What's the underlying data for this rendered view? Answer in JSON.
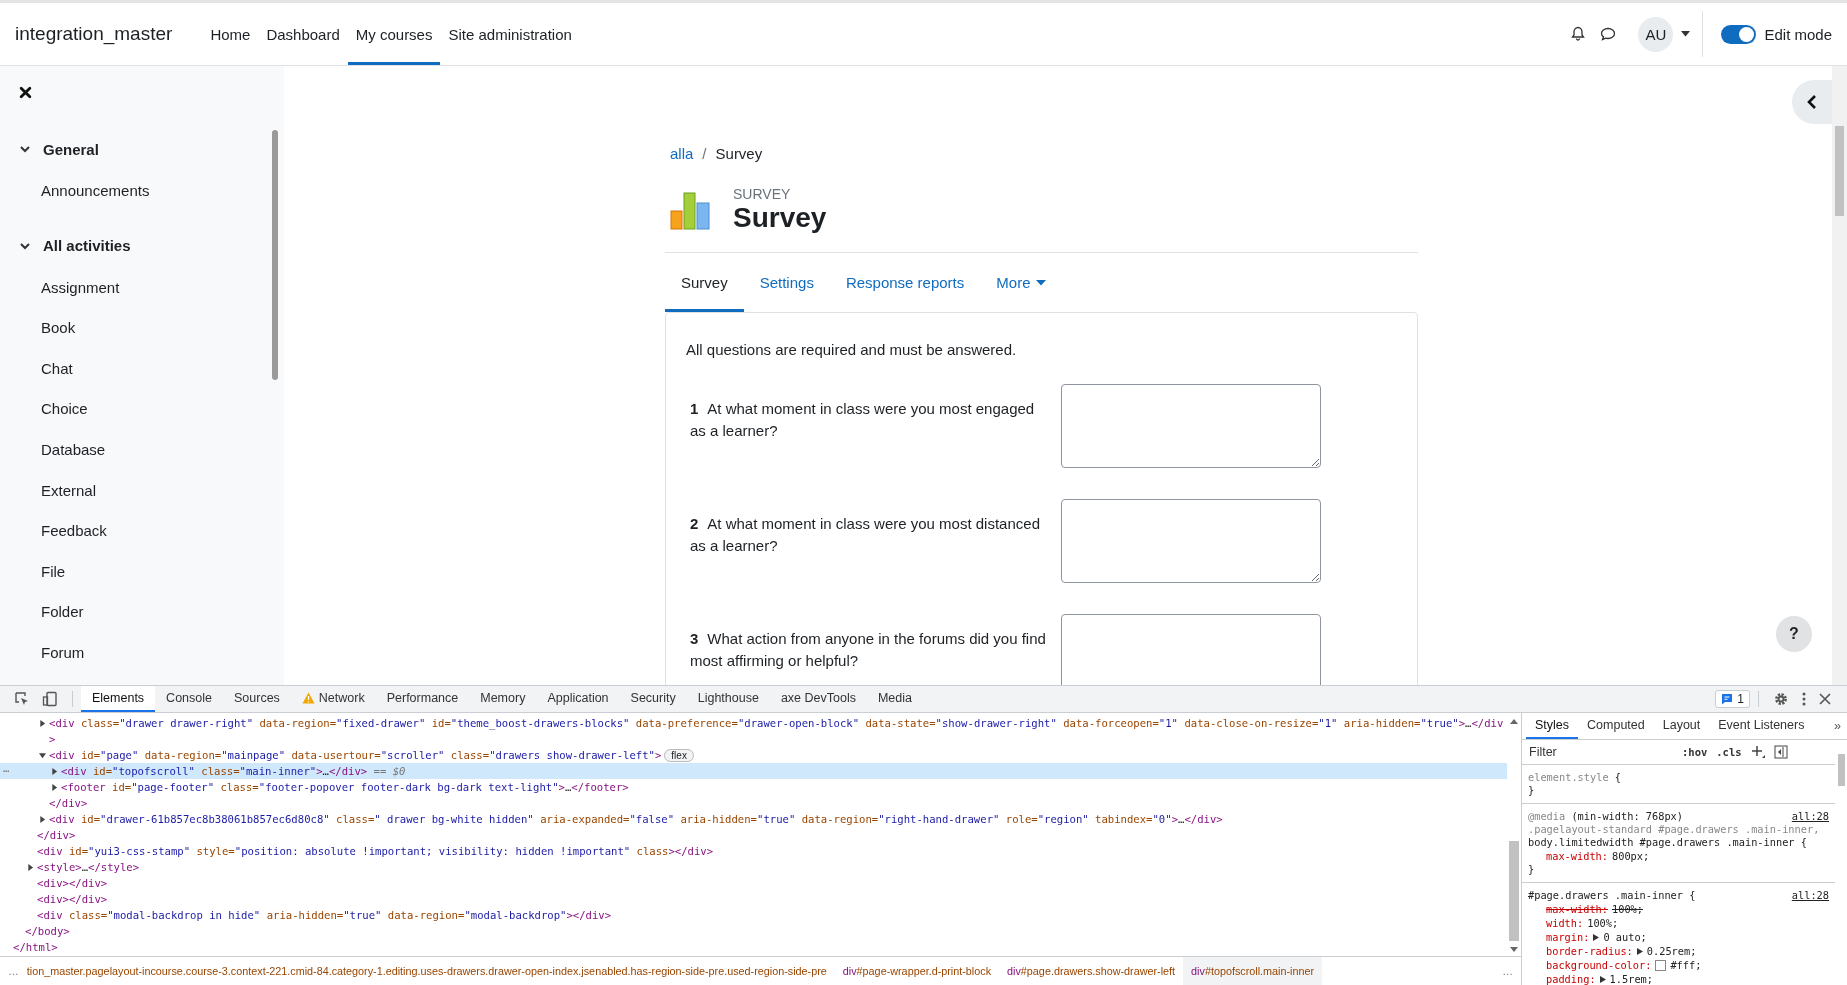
{
  "navbar": {
    "brand": "integration_master",
    "links": [
      {
        "label": "Home",
        "selected": false
      },
      {
        "label": "Dashboard",
        "selected": false
      },
      {
        "label": "My courses",
        "selected": true
      },
      {
        "label": "Site administration",
        "selected": false
      }
    ],
    "avatar": "AU",
    "edit_mode": {
      "label": "Edit mode",
      "on": true
    }
  },
  "drawer": {
    "sections": [
      {
        "title": "General",
        "expanded": true,
        "items": [
          "Announcements"
        ]
      },
      {
        "title": "All activities",
        "expanded": true,
        "items": [
          "Assignment",
          "Book",
          "Chat",
          "Choice",
          "Database",
          "External",
          "Feedback",
          "File",
          "Folder",
          "Forum"
        ]
      }
    ]
  },
  "breadcrumb": [
    {
      "label": "alla",
      "kind": "link"
    },
    {
      "label": "/",
      "kind": "separator"
    },
    {
      "label": "Survey",
      "kind": "current"
    }
  ],
  "activity": {
    "type_label": "SURVEY",
    "title": "Survey"
  },
  "tabs": [
    {
      "label": "Survey",
      "selected": true,
      "kind": "tab"
    },
    {
      "label": "Settings",
      "selected": false,
      "kind": "tab"
    },
    {
      "label": "Response reports",
      "selected": false,
      "kind": "tab"
    },
    {
      "label": "More",
      "selected": false,
      "kind": "menu"
    }
  ],
  "intro": "All questions are required and must be answered.",
  "questions": [
    {
      "number": "1",
      "text": "At what moment in class were you most engaged as a learner?"
    },
    {
      "number": "2",
      "text": "At what moment in class were you most distanced as a learner?"
    },
    {
      "number": "3",
      "text": "What action from anyone in the forums did you find most affirming or helpful?"
    }
  ],
  "help_button": "?",
  "devtools": {
    "tabs": [
      {
        "label": "Elements",
        "selected": true,
        "warning": false
      },
      {
        "label": "Console",
        "selected": false,
        "warning": false
      },
      {
        "label": "Sources",
        "selected": false,
        "warning": false
      },
      {
        "label": "Network",
        "selected": false,
        "warning": true
      },
      {
        "label": "Performance",
        "selected": false,
        "warning": false
      },
      {
        "label": "Memory",
        "selected": false,
        "warning": false
      },
      {
        "label": "Application",
        "selected": false,
        "warning": false
      },
      {
        "label": "Security",
        "selected": false,
        "warning": false
      },
      {
        "label": "Lighthouse",
        "selected": false,
        "warning": false
      },
      {
        "label": "axe DevTools",
        "selected": false,
        "warning": false
      },
      {
        "label": "Media",
        "selected": false,
        "warning": false
      }
    ],
    "issues_count": "1",
    "selected_marker": "…",
    "dom": [
      {
        "selected": false,
        "close": [
          {
            "kind": "tag",
            "text": "</html>"
          }
        ],
        "children": [
          {
            "selected": false,
            "close": [
              {
                "kind": "tag",
                "text": "</body>"
              }
            ],
            "children": [
              {
                "selected": false,
                "close": [
                  {
                    "kind": "tag",
                    "text": "</div>"
                  }
                ],
                "children": [
                  {
                    "expanded": false,
                    "selected": false,
                    "open": [
                      {
                        "kind": "tag",
                        "text": "<div"
                      },
                      {
                        "kind": "attr",
                        "text": " class="
                      },
                      {
                        "kind": "value",
                        "text": "\"drawer drawer-right\""
                      },
                      {
                        "kind": "attr",
                        "text": " data-region="
                      },
                      {
                        "kind": "value",
                        "text": "\"fixed-drawer\""
                      },
                      {
                        "kind": "attr",
                        "text": " id="
                      },
                      {
                        "kind": "value",
                        "text": "\"theme_boost-drawers-blocks\""
                      },
                      {
                        "kind": "attr",
                        "text": " data-preference="
                      },
                      {
                        "kind": "value",
                        "text": "\"drawer-open-block\""
                      },
                      {
                        "kind": "attr",
                        "text": " data-state="
                      },
                      {
                        "kind": "value",
                        "text": "\"show-drawer-right\""
                      },
                      {
                        "kind": "attr",
                        "text": " data-forceopen="
                      },
                      {
                        "kind": "value",
                        "text": "\"1\""
                      },
                      {
                        "kind": "attr",
                        "text": " data-close-on-resize="
                      },
                      {
                        "kind": "value",
                        "text": "\"1\""
                      },
                      {
                        "kind": "attr",
                        "text": " aria-hidden="
                      },
                      {
                        "kind": "value",
                        "text": "\"true\""
                      },
                      {
                        "kind": "tag",
                        "text": ">"
                      },
                      {
                        "kind": "text",
                        "text": "…"
                      },
                      {
                        "kind": "tag",
                        "text": "</div>"
                      }
                    ]
                  },
                  {
                    "expanded": true,
                    "selected": false,
                    "open": [
                      {
                        "kind": "tag",
                        "text": "<div"
                      },
                      {
                        "kind": "attr",
                        "text": " id="
                      },
                      {
                        "kind": "value",
                        "text": "\"page\""
                      },
                      {
                        "kind": "attr",
                        "text": " data-region="
                      },
                      {
                        "kind": "value",
                        "text": "\"mainpage\""
                      },
                      {
                        "kind": "attr",
                        "text": " data-usertour="
                      },
                      {
                        "kind": "value",
                        "text": "\"scroller\""
                      },
                      {
                        "kind": "attr",
                        "text": " class="
                      },
                      {
                        "kind": "value",
                        "text": "\"drawers show-drawer-left\""
                      },
                      {
                        "kind": "tag",
                        "text": ">"
                      },
                      {
                        "kind": "badge",
                        "text": "flex"
                      }
                    ],
                    "close": [
                      {
                        "kind": "tag",
                        "text": "</div>"
                      }
                    ],
                    "children": [
                      {
                        "expanded": false,
                        "selected": true,
                        "open": [
                          {
                            "kind": "tag",
                            "text": "<div"
                          },
                          {
                            "kind": "attr",
                            "text": " id="
                          },
                          {
                            "kind": "value",
                            "text": "\"topofscroll\""
                          },
                          {
                            "kind": "attr",
                            "text": " class="
                          },
                          {
                            "kind": "value",
                            "text": "\"main-inner\""
                          },
                          {
                            "kind": "tag",
                            "text": ">"
                          },
                          {
                            "kind": "text",
                            "text": "…"
                          },
                          {
                            "kind": "tag",
                            "text": "</div>"
                          },
                          {
                            "kind": "comment",
                            "text": " == $0"
                          }
                        ]
                      },
                      {
                        "expanded": false,
                        "selected": false,
                        "open": [
                          {
                            "kind": "tag",
                            "text": "<footer"
                          },
                          {
                            "kind": "attr",
                            "text": " id="
                          },
                          {
                            "kind": "value",
                            "text": "\"page-footer\""
                          },
                          {
                            "kind": "attr",
                            "text": " class="
                          },
                          {
                            "kind": "value",
                            "text": "\"footer-popover footer-dark bg-dark text-light\""
                          },
                          {
                            "kind": "tag",
                            "text": ">"
                          },
                          {
                            "kind": "text",
                            "text": "…"
                          },
                          {
                            "kind": "tag",
                            "text": "</footer>"
                          }
                        ]
                      }
                    ]
                  },
                  {
                    "expanded": false,
                    "selected": false,
                    "open": [
                      {
                        "kind": "tag",
                        "text": "<div"
                      },
                      {
                        "kind": "attr",
                        "text": " id="
                      },
                      {
                        "kind": "value",
                        "text": "\"drawer-61b857ec8b38061b857ec6d80c8\""
                      },
                      {
                        "kind": "attr",
                        "text": " class="
                      },
                      {
                        "kind": "value",
                        "text": "\" drawer bg-white hidden\""
                      },
                      {
                        "kind": "attr",
                        "text": " aria-expanded="
                      },
                      {
                        "kind": "value",
                        "text": "\"false\""
                      },
                      {
                        "kind": "attr",
                        "text": " aria-hidden="
                      },
                      {
                        "kind": "value",
                        "text": "\"true\""
                      },
                      {
                        "kind": "attr",
                        "text": " data-region="
                      },
                      {
                        "kind": "value",
                        "text": "\"right-hand-drawer\""
                      },
                      {
                        "kind": "attr",
                        "text": " role="
                      },
                      {
                        "kind": "value",
                        "text": "\"region\""
                      },
                      {
                        "kind": "attr",
                        "text": " tabindex="
                      },
                      {
                        "kind": "value",
                        "text": "\"0\""
                      },
                      {
                        "kind": "tag",
                        "text": ">"
                      },
                      {
                        "kind": "text",
                        "text": "…"
                      },
                      {
                        "kind": "tag",
                        "text": "</div>"
                      }
                    ]
                  }
                ]
              },
              {
                "selected": false,
                "open": [
                  {
                    "kind": "tag",
                    "text": "<div"
                  },
                  {
                    "kind": "attr",
                    "text": " id="
                  },
                  {
                    "kind": "value",
                    "text": "\"yui3-css-stamp\""
                  },
                  {
                    "kind": "attr",
                    "text": " style="
                  },
                  {
                    "kind": "value",
                    "text": "\"position: absolute !important; visibility: hidden !important\""
                  },
                  {
                    "kind": "attr",
                    "text": " class"
                  },
                  {
                    "kind": "tag",
                    "text": "></div>"
                  }
                ]
              },
              {
                "expanded": false,
                "selected": false,
                "open": [
                  {
                    "kind": "tag",
                    "text": "<style>"
                  },
                  {
                    "kind": "text",
                    "text": "…"
                  },
                  {
                    "kind": "tag",
                    "text": "</style>"
                  }
                ]
              },
              {
                "selected": false,
                "open": [
                  {
                    "kind": "tag",
                    "text": "<div></div>"
                  }
                ]
              },
              {
                "selected": false,
                "open": [
                  {
                    "kind": "tag",
                    "text": "<div></div>"
                  }
                ]
              },
              {
                "selected": false,
                "open": [
                  {
                    "kind": "tag",
                    "text": "<div"
                  },
                  {
                    "kind": "attr",
                    "text": " class="
                  },
                  {
                    "kind": "value",
                    "text": "\"modal-backdrop in hide\""
                  },
                  {
                    "kind": "attr",
                    "text": " aria-hidden="
                  },
                  {
                    "kind": "value",
                    "text": "\"true\""
                  },
                  {
                    "kind": "attr",
                    "text": " data-region="
                  },
                  {
                    "kind": "value",
                    "text": "\"modal-backdrop\""
                  },
                  {
                    "kind": "tag",
                    "text": "></div>"
                  }
                ]
              }
            ]
          }
        ]
      }
    ],
    "crumbs": [
      {
        "rest": "tion_master.pagelayout-incourse.course-3.context-221.cmid-84.category-1.editing.uses-drawers.drawer-open-index.jsenabled.has-region-side-pre.used-region-side-pre",
        "selected": false
      },
      {
        "tag": "div",
        "rest": "#page-wrapper.d-print-block",
        "selected": false
      },
      {
        "tag": "div",
        "rest": "#page.drawers.show-drawer-left",
        "selected": false
      },
      {
        "tag": "div",
        "rest": "#topofscroll.main-inner",
        "selected": true
      }
    ],
    "crumb_more": [
      "…",
      "…"
    ],
    "styles": {
      "tabs": [
        {
          "label": "Styles",
          "selected": true
        },
        {
          "label": "Computed",
          "selected": false
        },
        {
          "label": "Layout",
          "selected": false
        },
        {
          "label": "Event Listeners",
          "selected": false
        }
      ],
      "more_tabs": "»",
      "filter_placeholder": "Filter",
      "hov": ":hov",
      "cls": ".cls",
      "rules": [
        {
          "selectors": [
            {
              "text": "element.style",
              "matched": false
            }
          ],
          "brace_open": " {",
          "brace_close": "}"
        },
        {
          "media": [
            {
              "kind": "at",
              "text": "@media"
            },
            {
              "kind": "query",
              "text": " (min-width: 768px)"
            }
          ],
          "source": "all:28",
          "selectors": [
            {
              "text": ".pagelayout-standard #page.drawers .main-inner,",
              "matched": false
            },
            {
              "text": " body.limitedwidth #page.drawers .main-inner",
              "matched": true
            }
          ],
          "brace_open": " {",
          "brace_close": "}",
          "declarations": [
            {
              "name": "max-width:",
              "value": "800px;",
              "overridden": false
            }
          ]
        },
        {
          "source": "all:28",
          "selectors": [
            {
              "text": "#page.drawers .main-inner",
              "matched": true
            }
          ],
          "brace_open": " {",
          "declarations": [
            {
              "name": "max-width:",
              "value": "100%;",
              "overridden": true
            },
            {
              "name": "width:",
              "value": "100%;",
              "overridden": false
            },
            {
              "name": "margin:",
              "value": "0 auto;",
              "overridden": false,
              "expandable": true
            },
            {
              "name": "border-radius:",
              "value": "0.25rem;",
              "overridden": false,
              "expandable": true
            },
            {
              "name": "background-color:",
              "value": "#fff;",
              "overridden": false,
              "color": "#ffffff"
            },
            {
              "name": "padding:",
              "value": "1.5rem;",
              "overridden": false,
              "expandable": true
            }
          ]
        }
      ]
    }
  }
}
